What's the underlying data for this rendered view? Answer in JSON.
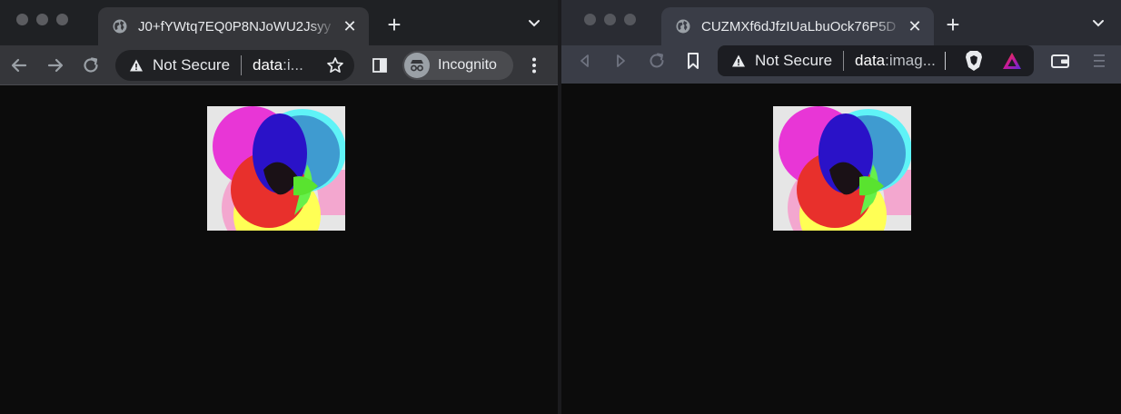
{
  "left_window": {
    "browser": "Chrome",
    "tab": {
      "title": "J0+fYWtq7EQ0P8NJoWU2Jsyy",
      "icon": "globe-icon",
      "close_label": "✕"
    },
    "new_tab_label": "+",
    "address": {
      "security_label": "Not Secure",
      "url_scheme": "data",
      "url_rest": ":i..."
    },
    "incognito_label": "Incognito"
  },
  "right_window": {
    "browser": "Brave",
    "tab": {
      "title": "CUZMXf6dJfzIUaLbuOck76P5D",
      "icon": "globe-icon",
      "close_label": "✕"
    },
    "new_tab_label": "+",
    "address": {
      "security_label": "Not Secure",
      "url_scheme": "data",
      "url_rest": ":imag..."
    }
  },
  "rendered_image": {
    "description_colors": [
      "#ff00ff",
      "#00ffff",
      "#ffff00",
      "#ff0000",
      "#0000ff",
      "#00ff00",
      "#000000",
      "#ff9ad5"
    ]
  }
}
